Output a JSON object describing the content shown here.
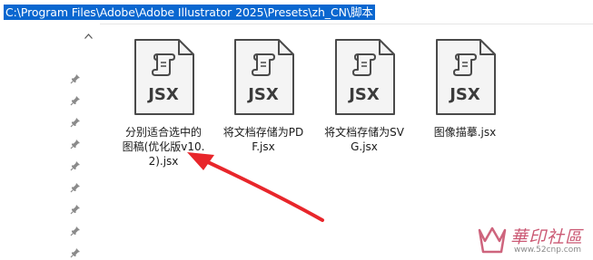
{
  "address_bar": {
    "path": "C:\\Program Files\\Adobe\\Adobe Illustrator 2025\\Presets\\zh_CN\\脚本"
  },
  "quick_access": {
    "pin_count": 9
  },
  "files": [
    {
      "type_label": "JSX",
      "name": "分别适合选中的图稿(优化版v10.2).jsx"
    },
    {
      "type_label": "JSX",
      "name": "将文档存储为PDF.jsx"
    },
    {
      "type_label": "JSX",
      "name": "将文档存储为SVG.jsx"
    },
    {
      "type_label": "JSX",
      "name": "图像描摹.jsx"
    }
  ],
  "annotation": {
    "arrow_color": "#e8262b"
  },
  "watermark": {
    "brand_text": "華印社區",
    "url": "www.52cnp.com"
  },
  "colors": {
    "selection": "#0a67d0",
    "icon_stroke": "#4a4a4a"
  }
}
